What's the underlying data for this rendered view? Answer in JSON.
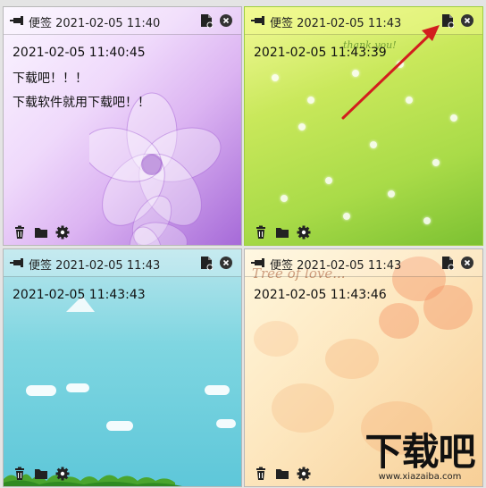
{
  "notes": [
    {
      "title": "便签 2021-02-05 11:40",
      "lines": [
        "2021-02-05 11:40:45",
        "下载吧！！！",
        "下载软件就用下载吧！！"
      ]
    },
    {
      "title": "便签 2021-02-05 11:43",
      "lines": [
        "2021-02-05 11:43:39"
      ]
    },
    {
      "title": "便签 2021-02-05 11:43",
      "lines": [
        "2021-02-05 11:43:43"
      ]
    },
    {
      "title": "便签 2021-02-05 11:43",
      "lines": [
        "2021-02-05 11:43:46"
      ]
    }
  ],
  "decor": {
    "note2_script": "thank you!",
    "note4_script": "Tree of love..."
  },
  "watermark": {
    "title": "下载吧",
    "url": "www.xiazaiba.com"
  },
  "colors": {
    "arrow": "#d21e1e",
    "note1_bg": "#e9cdf8",
    "note2_bg": "#b8de52",
    "note3_bg": "#7fd6e1",
    "note4_bg": "#fde7bf"
  }
}
